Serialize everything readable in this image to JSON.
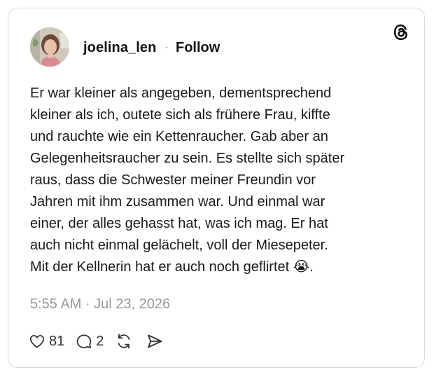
{
  "post": {
    "username": "joelina_len",
    "separator": "·",
    "follow_label": "Follow",
    "text": "Er war kleiner als angegeben, dementsprechend\nkleiner als ich, outete sich als frühere Frau, kiffte\nund rauchte wie ein Kettenraucher. Gab aber an\nGelegenheitsraucher zu sein. Es stellte sich später\nraus, dass die Schwester meiner Freundin vor\nJahren mit ihm zusammen war. Und einmal war\neiner, der alles gehasst hat, was ich mag. Er hat\nauch nicht einmal gelächelt, voll der Miesepeter.\nMit der Kellnerin hat er auch noch geflirtet 😭.",
    "timestamp": "5:55 AM · Jul 23, 2026"
  },
  "actions": {
    "likes": "81",
    "replies": "2"
  },
  "icons": {
    "brand": "threads-logo-icon",
    "like": "heart-icon",
    "reply": "speech-bubble-icon",
    "repost": "repost-arrows-icon",
    "share": "send-icon"
  },
  "colors": {
    "text": "#1a1a1a",
    "muted": "#999999",
    "border": "#d9d9d9"
  }
}
